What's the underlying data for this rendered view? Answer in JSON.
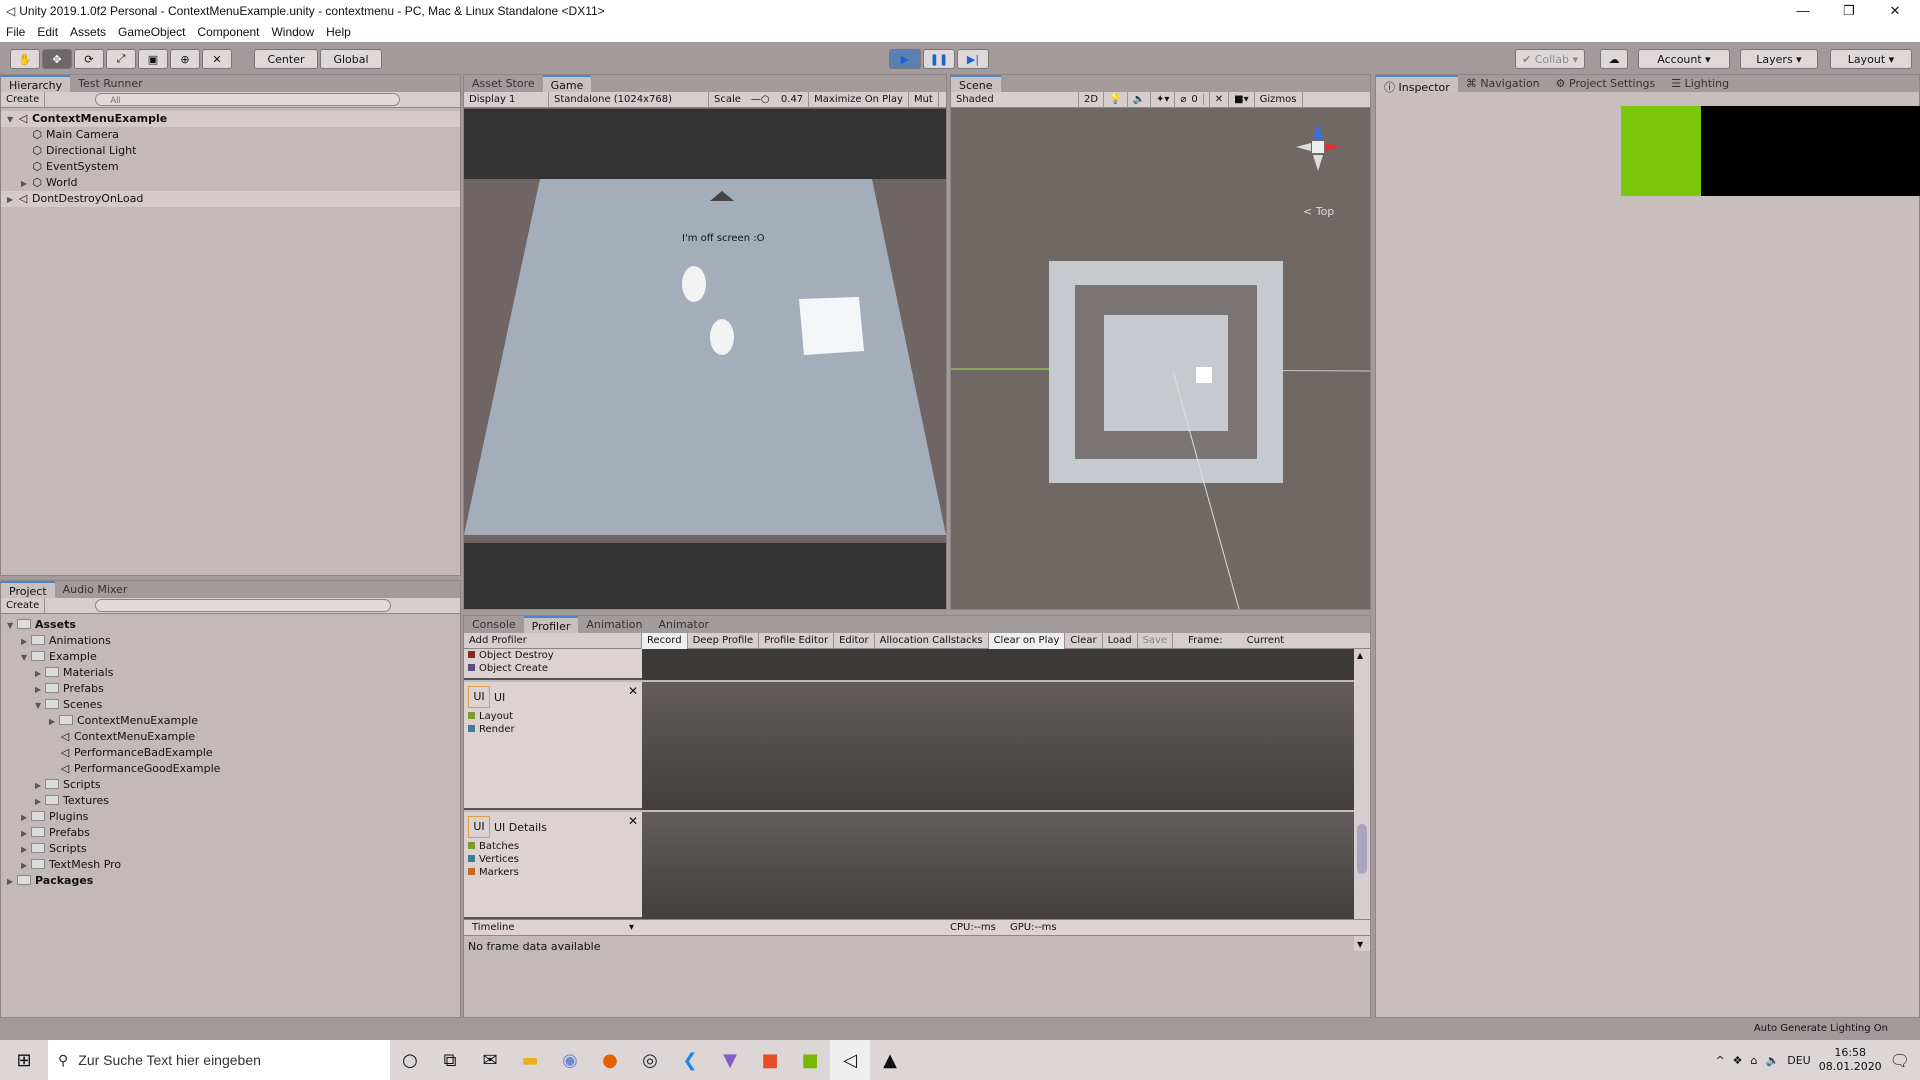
{
  "window": {
    "title": "Unity 2019.1.0f2 Personal - ContextMenuExample.unity - contextmenu - PC, Mac & Linux Standalone <DX11>"
  },
  "menu": [
    "File",
    "Edit",
    "Assets",
    "GameObject",
    "Component",
    "Window",
    "Help"
  ],
  "toolbar": {
    "center": "Center",
    "global": "Global",
    "collab": "Collab",
    "account": "Account",
    "layers": "Layers",
    "layout": "Layout"
  },
  "hierarchy": {
    "tabs": [
      "Hierarchy",
      "Test Runner"
    ],
    "create": "Create",
    "search_placeholder": "All",
    "items": [
      {
        "label": "ContextMenuExample",
        "depth": 0,
        "bold": true,
        "expanded": true
      },
      {
        "label": "Main Camera",
        "depth": 1
      },
      {
        "label": "Directional Light",
        "depth": 1
      },
      {
        "label": "EventSystem",
        "depth": 1
      },
      {
        "label": "World",
        "depth": 1,
        "collapsed": true
      },
      {
        "label": "DontDestroyOnLoad",
        "depth": 0,
        "collapsed": true
      }
    ]
  },
  "game": {
    "tabs": [
      "Asset Store",
      "Game"
    ],
    "display": "Display 1",
    "resolution": "Standalone (1024x768)",
    "scale_label": "Scale",
    "scale_value": "0.47",
    "maximize": "Maximize On Play",
    "mute": "Mut",
    "overlay_text": "I'm off screen :O"
  },
  "scene": {
    "tab": "Scene",
    "shading": "Shaded",
    "mode_2d": "2D",
    "gizmos": "Gizmos",
    "hidden_count": "0",
    "view_label": "Top"
  },
  "inspector": {
    "tabs": [
      "Inspector",
      "Navigation",
      "Project Settings",
      "Lighting"
    ],
    "colors": {
      "green": "#7ac70c",
      "black": "#000000"
    }
  },
  "project": {
    "tabs": [
      "Project",
      "Audio Mixer"
    ],
    "create": "Create",
    "items": [
      {
        "label": "Assets",
        "depth": 0,
        "bold": true,
        "expanded": true
      },
      {
        "label": "Animations",
        "depth": 1
      },
      {
        "label": "Example",
        "depth": 1,
        "expanded": true
      },
      {
        "label": "Materials",
        "depth": 2
      },
      {
        "label": "Prefabs",
        "depth": 2
      },
      {
        "label": "Scenes",
        "depth": 2,
        "expanded": true
      },
      {
        "label": "ContextMenuExample",
        "depth": 3
      },
      {
        "label": "ContextMenuExample",
        "depth": 3,
        "scene": true
      },
      {
        "label": "PerformanceBadExample",
        "depth": 3,
        "scene": true
      },
      {
        "label": "PerformanceGoodExample",
        "depth": 3,
        "scene": true
      },
      {
        "label": "Scripts",
        "depth": 2
      },
      {
        "label": "Textures",
        "depth": 2
      },
      {
        "label": "Plugins",
        "depth": 1
      },
      {
        "label": "Prefabs",
        "depth": 1
      },
      {
        "label": "Scripts",
        "depth": 1
      },
      {
        "label": "TextMesh Pro",
        "depth": 1
      },
      {
        "label": "Packages",
        "depth": 0,
        "bold": true
      }
    ]
  },
  "profiler": {
    "tabs": [
      "Console",
      "Profiler",
      "Animation",
      "Animator"
    ],
    "toolbar": [
      "Record",
      "Deep Profile",
      "Profile Editor",
      "Editor",
      "Allocation Callstacks",
      "Clear on Play",
      "Clear",
      "Load",
      "Save",
      "Frame:",
      "Current"
    ],
    "add_profiler": "Add Profiler",
    "memory_items": [
      {
        "label": "Object Destroy",
        "color": "#8b2a1a"
      },
      {
        "label": "Object Create",
        "color": "#5a4a8a"
      }
    ],
    "modules": [
      {
        "icon": "UI",
        "title": "UI",
        "items": [
          {
            "label": "Layout",
            "color": "#7d9a2a"
          },
          {
            "label": "Render",
            "color": "#3d7d96"
          }
        ]
      },
      {
        "icon": "UI",
        "title": "UI Details",
        "items": [
          {
            "label": "Batches",
            "color": "#7d9a2a"
          },
          {
            "label": "Vertices",
            "color": "#3d7d96"
          },
          {
            "label": "Markers",
            "color": "#c06a1a"
          }
        ]
      }
    ],
    "view": "Timeline",
    "cpu": "CPU:--ms",
    "gpu": "GPU:--ms",
    "no_data": "No frame data available"
  },
  "status": {
    "text": "Auto Generate Lighting On"
  },
  "taskbar": {
    "search_placeholder": "Zur Suche Text hier eingeben",
    "lang": "DEU",
    "time": "16:58",
    "date": "08.01.2020"
  }
}
